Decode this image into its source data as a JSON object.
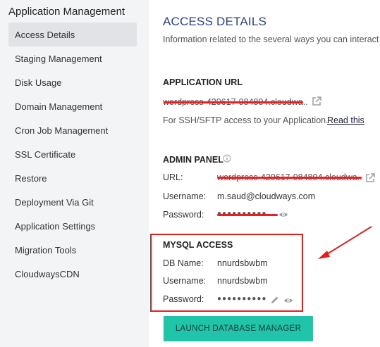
{
  "sidebar": {
    "title": "Application Management",
    "items": [
      {
        "label": "Access Details",
        "active": true
      },
      {
        "label": "Staging Management"
      },
      {
        "label": "Disk Usage"
      },
      {
        "label": "Domain Management"
      },
      {
        "label": "Cron Job Management"
      },
      {
        "label": "SSL Certificate"
      },
      {
        "label": "Restore"
      },
      {
        "label": "Deployment Via Git"
      },
      {
        "label": "Application Settings"
      },
      {
        "label": "Migration Tools"
      },
      {
        "label": "CloudwaysCDN"
      }
    ]
  },
  "main": {
    "title": "ACCESS DETAILS",
    "description": "Information related to the several ways you can interact",
    "app_url": {
      "heading": "APPLICATION URL",
      "value": "wordpress-420617-984804.cloudwa...",
      "sftp_text": "For SSH/SFTP access to your Application.",
      "read_this": "Read this"
    },
    "admin_panel": {
      "heading": "ADMIN PANEL",
      "url_label": "URL:",
      "url_value": "wordpress-420617-984804.cloudwa...",
      "username_label": "Username:",
      "username_value": "m.saud@cloudways.com",
      "password_label": "Password:",
      "password_value": "●●●●●●●●●●"
    },
    "mysql": {
      "heading": "MYSQL ACCESS",
      "db_label": "DB Name:",
      "db_value": "nnurdsbwbm",
      "username_label": "Username:",
      "username_value": "nnurdsbwbm",
      "password_label": "Password:",
      "password_value": "●●●●●●●●●●"
    },
    "launch_button": "LAUNCH DATABASE MANAGER"
  },
  "colors": {
    "accent_title": "#2a3f8f",
    "annotation_red": "#e3201a",
    "button_teal": "#20c4a8"
  },
  "icons": {
    "external_link": "external-link-icon",
    "info": "info-icon",
    "eye": "eye-icon",
    "pencil": "pencil-icon"
  }
}
